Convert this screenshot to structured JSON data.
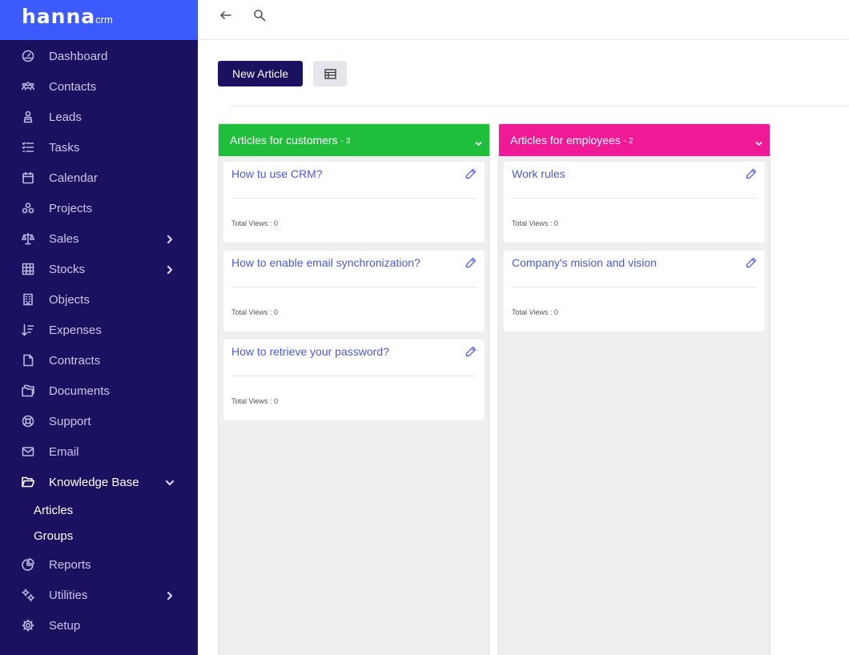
{
  "app": {
    "brand": "hanna",
    "brand_sub": "crm"
  },
  "colors": {
    "sidebar_bg": "#1a1260",
    "logo_bg": "#3b5bfd",
    "customers": "#1fbf3c",
    "employees": "#f01a96",
    "link": "#4a5be0"
  },
  "sidebar": {
    "items": [
      {
        "label": "Dashboard",
        "icon": "dashboard-icon"
      },
      {
        "label": "Contacts",
        "icon": "contacts-icon"
      },
      {
        "label": "Leads",
        "icon": "leads-icon"
      },
      {
        "label": "Tasks",
        "icon": "tasks-icon"
      },
      {
        "label": "Calendar",
        "icon": "calendar-icon"
      },
      {
        "label": "Projects",
        "icon": "projects-icon"
      },
      {
        "label": "Sales",
        "icon": "sales-icon"
      },
      {
        "label": "Stocks",
        "icon": "stocks-icon"
      },
      {
        "label": "Objects",
        "icon": "objects-icon"
      },
      {
        "label": "Expenses",
        "icon": "expenses-icon"
      },
      {
        "label": "Contracts",
        "icon": "contracts-icon"
      },
      {
        "label": "Documents",
        "icon": "documents-icon"
      },
      {
        "label": "Support",
        "icon": "support-icon"
      },
      {
        "label": "Email",
        "icon": "email-icon"
      },
      {
        "label": "Knowledge Base",
        "icon": "knowledge-base-icon"
      },
      {
        "label": "Reports",
        "icon": "reports-icon"
      },
      {
        "label": "Utilities",
        "icon": "utilities-icon"
      },
      {
        "label": "Setup",
        "icon": "setup-icon"
      }
    ],
    "subitems": [
      {
        "label": "Articles"
      },
      {
        "label": "Groups"
      }
    ]
  },
  "toolbar": {
    "new_article": "New Article"
  },
  "columns": [
    {
      "title": "Articles for customers",
      "count": "- 3",
      "articles": [
        {
          "title": "How tu use CRM?",
          "views": "Total Views : 0"
        },
        {
          "title": "How to enable email synchronization?",
          "views": "Total Views : 0"
        },
        {
          "title": "How to retrieve your password?",
          "views": "Total Views : 0"
        }
      ]
    },
    {
      "title": "Articles for employees",
      "count": "- 2",
      "articles": [
        {
          "title": "Work rules",
          "views": "Total Views : 0"
        },
        {
          "title": "Company's mision and vision",
          "views": "Total Views : 0"
        }
      ]
    }
  ]
}
